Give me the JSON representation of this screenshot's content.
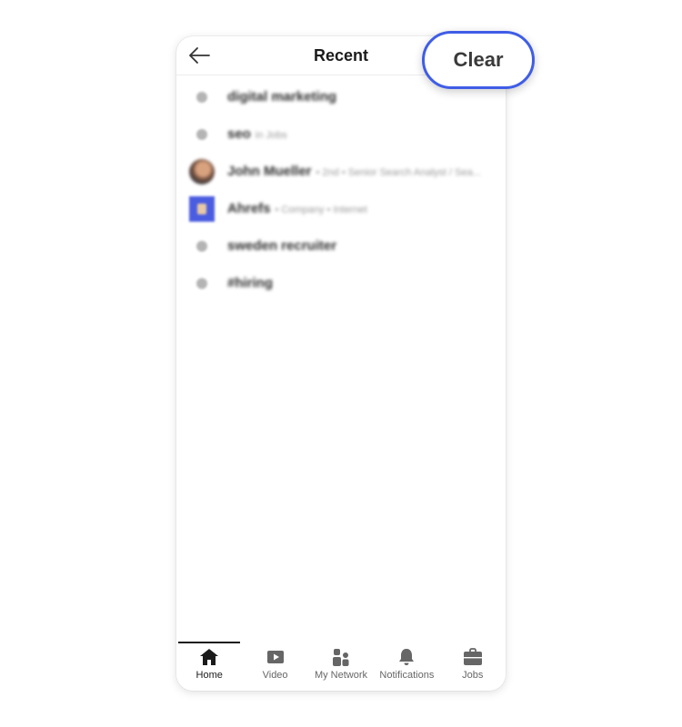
{
  "header": {
    "title": "Recent"
  },
  "clear_button": {
    "label": "Clear"
  },
  "recent": [
    {
      "type": "search",
      "title": "digital marketing",
      "subtitle": ""
    },
    {
      "type": "search",
      "title": "seo",
      "subtitle": "in Jobs"
    },
    {
      "type": "person",
      "title": "John Mueller",
      "subtitle": "• 2nd • Senior Search Analyst / Sea..."
    },
    {
      "type": "company",
      "title": "Ahrefs",
      "subtitle": "• Company • Internet"
    },
    {
      "type": "search",
      "title": "sweden recruiter",
      "subtitle": ""
    },
    {
      "type": "search",
      "title": "#hiring",
      "subtitle": ""
    }
  ],
  "nav": [
    {
      "key": "home",
      "label": "Home",
      "icon": "home-icon",
      "active": true
    },
    {
      "key": "video",
      "label": "Video",
      "icon": "video-icon",
      "active": false
    },
    {
      "key": "my-network",
      "label": "My Network",
      "icon": "people-icon",
      "active": false
    },
    {
      "key": "notifications",
      "label": "Notifications",
      "icon": "bell-icon",
      "active": false
    },
    {
      "key": "jobs",
      "label": "Jobs",
      "icon": "briefcase-icon",
      "active": false
    }
  ],
  "colors": {
    "accent": "#3f5de6",
    "company_logo": "#4a5ce0",
    "text": "#1b1b1b",
    "muted": "#666666"
  }
}
